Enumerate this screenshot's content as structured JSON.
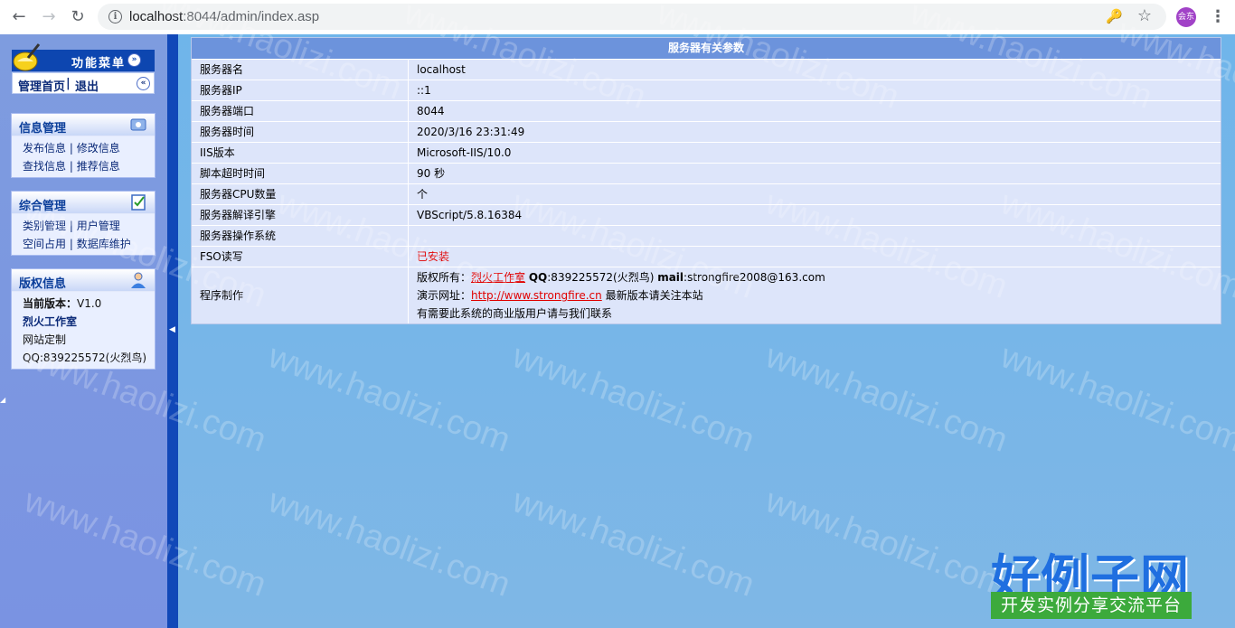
{
  "browser": {
    "url_host": "localhost",
    "url_rest": ":8044/admin/index.asp",
    "profile_initials": "会东"
  },
  "menu": {
    "title": "功能菜单",
    "home_link": "管理首页",
    "separator": "|",
    "logout_link": "退出"
  },
  "panels": {
    "info": {
      "title": "信息管理",
      "items": [
        "发布信息",
        "修改信息",
        "查找信息",
        "推荐信息"
      ]
    },
    "general": {
      "title": "综合管理",
      "items": [
        "类别管理",
        "用户管理",
        "空间占用",
        "数据库维护"
      ]
    },
    "copyright": {
      "title": "版权信息",
      "version_label": "当前版本：",
      "version": "V1.0",
      "studio": "烈火工作室",
      "custom": "网站定制",
      "qq": "QQ:839225572(火烈鸟)"
    }
  },
  "server": {
    "title": "服务器有关参数",
    "rows": [
      {
        "key": "服务器名",
        "value": "localhost"
      },
      {
        "key": "服务器IP",
        "value": "::1"
      },
      {
        "key": "服务器端口",
        "value": "8044"
      },
      {
        "key": "服务器时间",
        "value": "2020/3/16 23:31:49"
      },
      {
        "key": "IIS版本",
        "value": "Microsoft-IIS/10.0"
      },
      {
        "key": "脚本超时时间",
        "value": "90 秒"
      },
      {
        "key": "服务器CPU数量",
        "value": "个"
      },
      {
        "key": "服务器解译引擎",
        "value": "VBScript/5.8.16384"
      },
      {
        "key": "服务器操作系统",
        "value": ""
      },
      {
        "key": "FSO读写",
        "value": "已安装"
      }
    ],
    "credits": {
      "key": "程序制作",
      "line1_label": "版权所有：",
      "line1_link": "烈火工作室",
      "qq_label": "QQ",
      "qq_value": ":839225572(火烈鸟) ",
      "mail_label": "mail",
      "mail_value": ":strongfire2008@163.com",
      "line2_label": "演示网址：",
      "line2_link": "http://www.strongfire.cn",
      "line2_rest": " 最新版本请关注本站",
      "line3": "有需要此系统的商业版用户请与我们联系"
    }
  },
  "watermark": {
    "text": "www.haolizi.com",
    "brand": "好例子网",
    "brand_sub": "开发实例分享交流平台"
  },
  "colors": {
    "sidebar": "#7e9cdf",
    "divider": "#1148b8",
    "main_bg": "#6fb5ea",
    "table_head": "#6c93dc",
    "table_row": "#dde5fa",
    "accent_red": "#e00000"
  }
}
